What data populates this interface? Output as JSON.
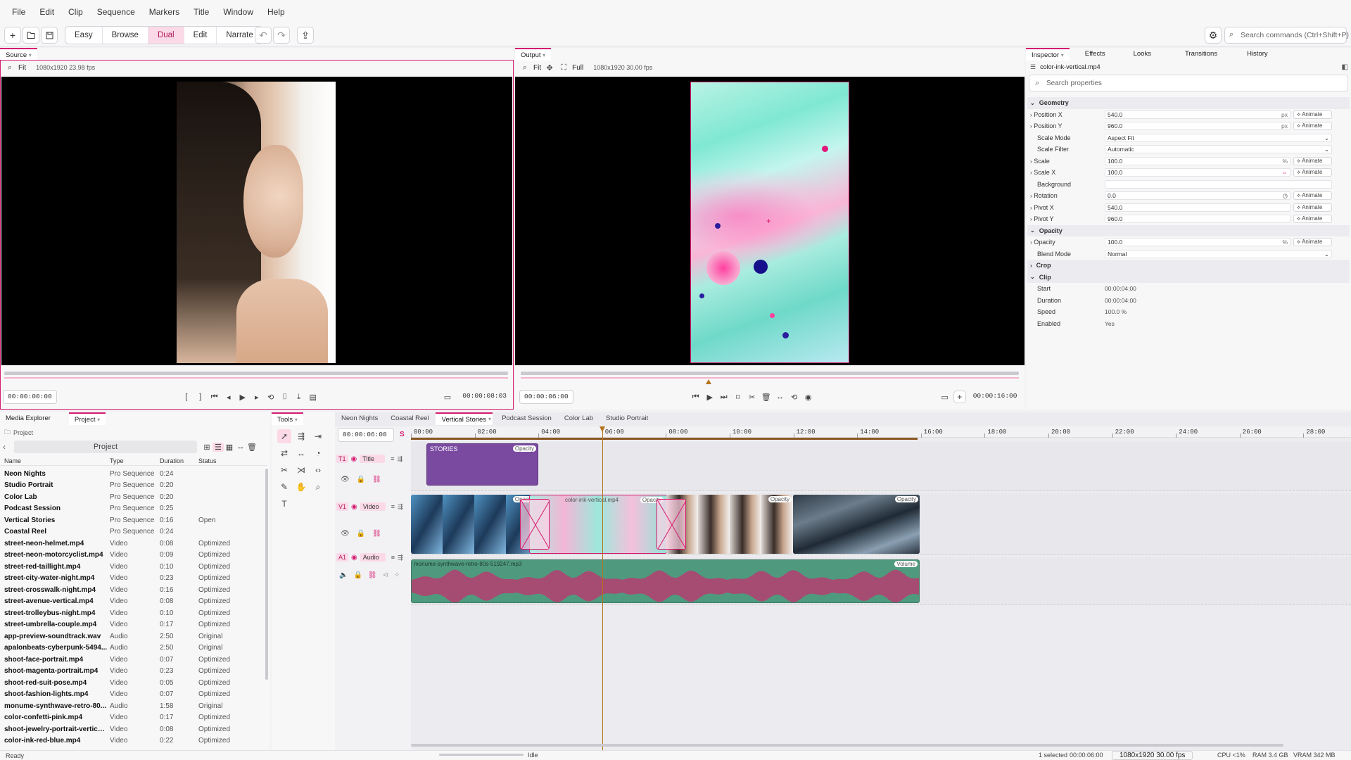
{
  "menu": [
    "File",
    "Edit",
    "Clip",
    "Sequence",
    "Markers",
    "Title",
    "Window",
    "Help"
  ],
  "modes": [
    "Easy",
    "Browse",
    "Dual",
    "Edit",
    "Narrate"
  ],
  "active_mode": "Dual",
  "search_commands": "Search commands (Ctrl+Shift+P)",
  "source": {
    "tab": "Source",
    "fit": "Fit",
    "info": "1080x1920  23.98 fps",
    "tc_in": "00:00:00:00",
    "tc_out": "00:00:08:03"
  },
  "output": {
    "tab": "Output",
    "fit": "Fit",
    "full": "Full",
    "info": "1080x1920  30.00 fps",
    "tc_in": "00:00:06:00",
    "tc_out": "00:00:16:00"
  },
  "inspector": {
    "tabs": [
      "Inspector",
      "Effects",
      "Looks",
      "Transitions",
      "History"
    ],
    "file": "color-ink-vertical.mp4",
    "search": "Search properties",
    "animate": "Animate",
    "geometry": "Geometry",
    "position_x": {
      "label": "Position X",
      "value": "540.0",
      "unit": "px"
    },
    "position_y": {
      "label": "Position Y",
      "value": "960.0",
      "unit": "px"
    },
    "scale_mode": {
      "label": "Scale Mode",
      "value": "Aspect Fit"
    },
    "scale_filter": {
      "label": "Scale Filter",
      "value": "Automatic"
    },
    "scale": {
      "label": "Scale",
      "value": "100.0",
      "unit": "%"
    },
    "scale_x": {
      "label": "Scale X",
      "value": "100.0"
    },
    "background": {
      "label": "Background"
    },
    "rotation": {
      "label": "Rotation",
      "value": "0.0"
    },
    "pivot_x": {
      "label": "Pivot X",
      "value": "540.0"
    },
    "pivot_y": {
      "label": "Pivot Y",
      "value": "960.0"
    },
    "opacity_section": "Opacity",
    "opacity": {
      "label": "Opacity",
      "value": "100.0",
      "unit": "%"
    },
    "blend_mode": {
      "label": "Blend Mode",
      "value": "Normal"
    },
    "crop": "Crop",
    "clip": "Clip",
    "start": {
      "label": "Start",
      "value": "00:00:04:00"
    },
    "duration": {
      "label": "Duration",
      "value": "00:00:04:00"
    },
    "speed": {
      "label": "Speed",
      "value": "100.0 %"
    },
    "enabled": {
      "label": "Enabled",
      "value": "Yes"
    }
  },
  "project": {
    "tabs": [
      "Media Explorer",
      "Project"
    ],
    "crumb": "Project",
    "title": "Project",
    "cols": [
      "Name",
      "Type",
      "Duration",
      "Status"
    ],
    "rows": [
      {
        "n": "Neon Nights",
        "t": "Pro Sequence",
        "d": "0:24",
        "s": ""
      },
      {
        "n": "Studio Portrait",
        "t": "Pro Sequence",
        "d": "0:20",
        "s": ""
      },
      {
        "n": "Color Lab",
        "t": "Pro Sequence",
        "d": "0:20",
        "s": ""
      },
      {
        "n": "Podcast Session",
        "t": "Pro Sequence",
        "d": "0:25",
        "s": ""
      },
      {
        "n": "Vertical Stories",
        "t": "Pro Sequence",
        "d": "0:16",
        "s": "Open"
      },
      {
        "n": "Coastal Reel",
        "t": "Pro Sequence",
        "d": "0:24",
        "s": ""
      },
      {
        "n": "street-neon-helmet.mp4",
        "t": "Video",
        "d": "0:08",
        "s": "Optimized"
      },
      {
        "n": "street-neon-motorcyclist.mp4",
        "t": "Video",
        "d": "0:09",
        "s": "Optimized"
      },
      {
        "n": "street-red-taillight.mp4",
        "t": "Video",
        "d": "0:10",
        "s": "Optimized"
      },
      {
        "n": "street-city-water-night.mp4",
        "t": "Video",
        "d": "0:23",
        "s": "Optimized"
      },
      {
        "n": "street-crosswalk-night.mp4",
        "t": "Video",
        "d": "0:16",
        "s": "Optimized"
      },
      {
        "n": "street-avenue-vertical.mp4",
        "t": "Video",
        "d": "0:08",
        "s": "Optimized"
      },
      {
        "n": "street-trolleybus-night.mp4",
        "t": "Video",
        "d": "0:10",
        "s": "Optimized"
      },
      {
        "n": "street-umbrella-couple.mp4",
        "t": "Video",
        "d": "0:17",
        "s": "Optimized"
      },
      {
        "n": "app-preview-soundtrack.wav",
        "t": "Audio",
        "d": "2:50",
        "s": "Original"
      },
      {
        "n": "apalonbeats-cyberpunk-5494...",
        "t": "Audio",
        "d": "2:50",
        "s": "Original"
      },
      {
        "n": "shoot-face-portrait.mp4",
        "t": "Video",
        "d": "0:07",
        "s": "Optimized"
      },
      {
        "n": "shoot-magenta-portrait.mp4",
        "t": "Video",
        "d": "0:23",
        "s": "Optimized"
      },
      {
        "n": "shoot-red-suit-pose.mp4",
        "t": "Video",
        "d": "0:05",
        "s": "Optimized"
      },
      {
        "n": "shoot-fashion-lights.mp4",
        "t": "Video",
        "d": "0:07",
        "s": "Optimized"
      },
      {
        "n": "monume-synthwave-retro-80...",
        "t": "Audio",
        "d": "1:58",
        "s": "Original"
      },
      {
        "n": "color-confetti-pink.mp4",
        "t": "Video",
        "d": "0:17",
        "s": "Optimized"
      },
      {
        "n": "shoot-jewelry-portrait-vertical...",
        "t": "Video",
        "d": "0:08",
        "s": "Optimized"
      },
      {
        "n": "color-ink-red-blue.mp4",
        "t": "Video",
        "d": "0:22",
        "s": "Optimized"
      }
    ]
  },
  "tools_tab": "Tools",
  "timeline": {
    "tabs": [
      "Neon Nights",
      "Coastal Reel",
      "Vertical Stories",
      "Podcast Session",
      "Color Lab",
      "Studio Portrait"
    ],
    "active_tab": "Vertical Stories",
    "timecode": "00:00:06:00",
    "ruler": [
      "00:00",
      "02:00",
      "04:00",
      "06:00",
      "08:00",
      "10:00",
      "12:00",
      "14:00",
      "16:00",
      "18:00",
      "20:00",
      "22:00",
      "24:00",
      "26:00",
      "28:00"
    ],
    "tracks": [
      {
        "id": "T1",
        "name": "Title"
      },
      {
        "id": "V1",
        "name": "Video"
      },
      {
        "id": "A1",
        "name": "Audio"
      }
    ],
    "title_clip": "STORIES",
    "opacity": "Opacity",
    "volume": "Volume",
    "ink_clip": "color-ink-vertical.mp4",
    "audio_clip": "monume-synthwave-retro-80s-519247.mp3"
  },
  "status": {
    "left": "Ready",
    "idle": "Idle",
    "selected": "1 selected",
    "tc": "00:00:06:00",
    "res": "1080x1920  30.00 fps",
    "cpu": "CPU <1%",
    "ram": "RAM 3.4 GB",
    "vram": "VRAM 342 MB"
  },
  "colors": {
    "accent": "#d61a6f",
    "title_clip": "#7a4aa0",
    "audio_clip": "#4f9a7e",
    "waveform": "#e0186a",
    "playhead": "#b5731a"
  }
}
